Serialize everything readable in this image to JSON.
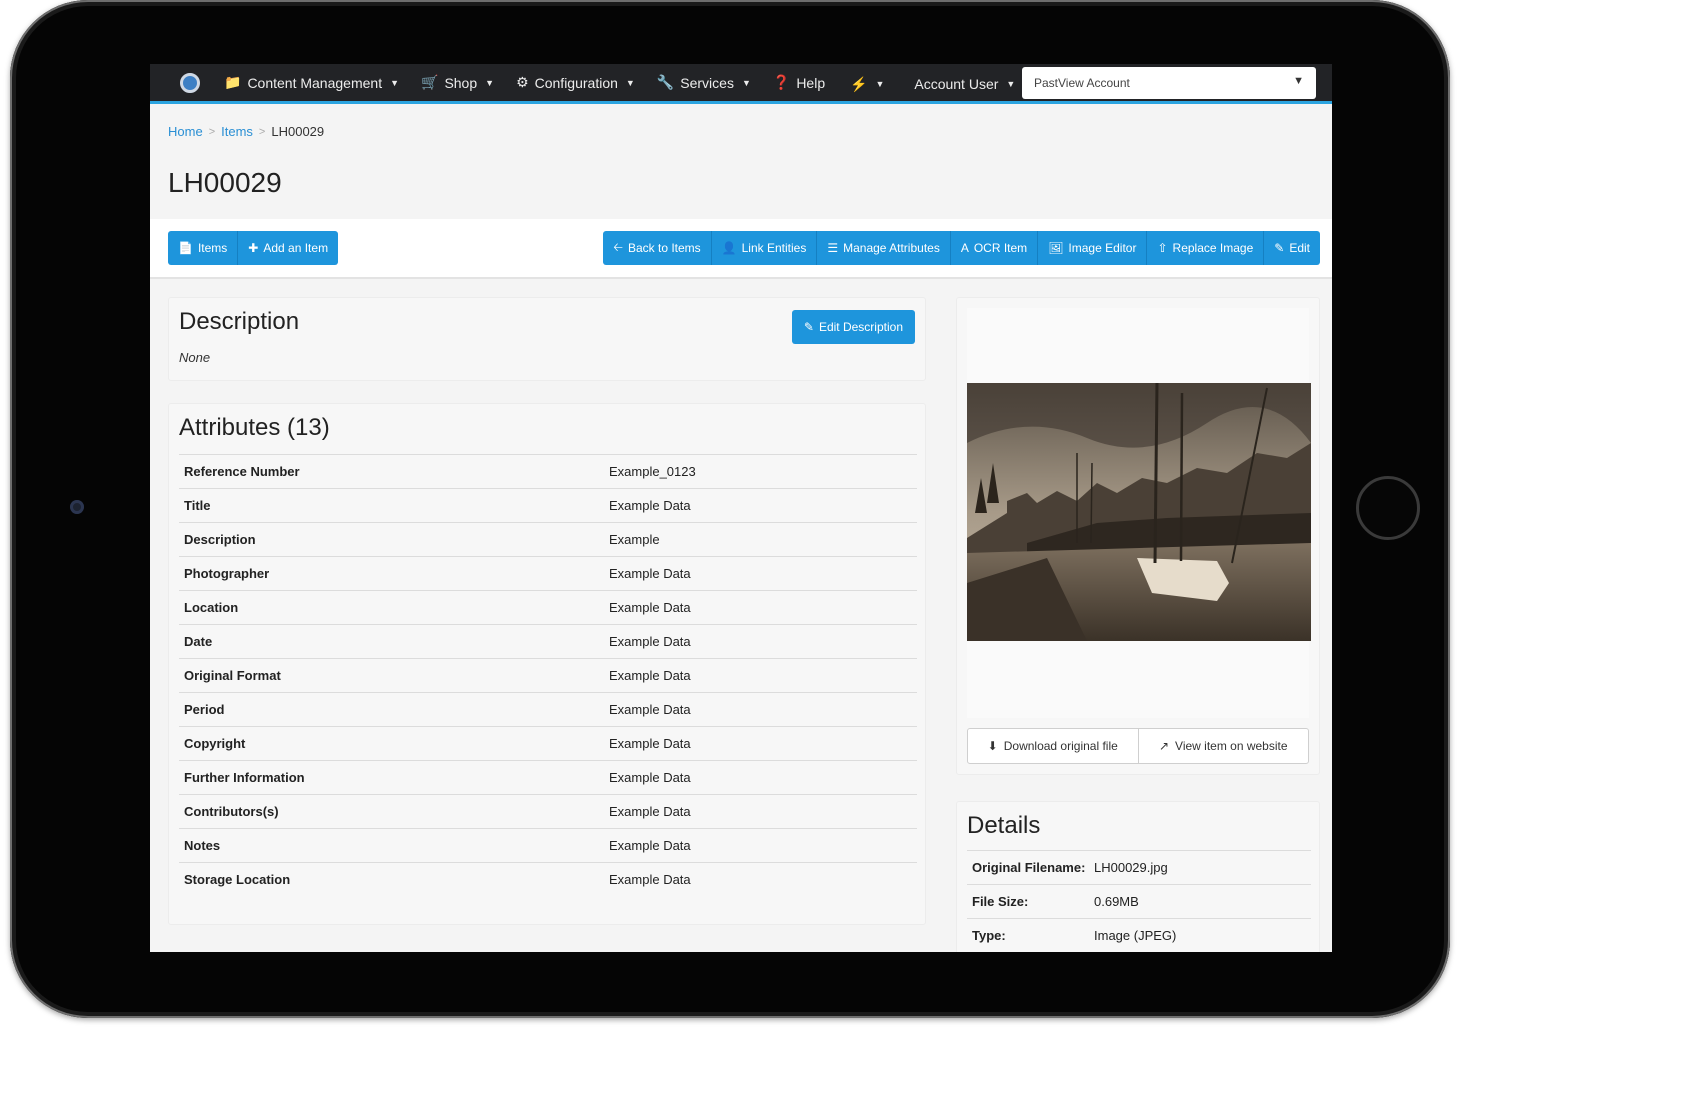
{
  "nav": {
    "items": [
      {
        "label": "Content Management",
        "icon": "folder-icon"
      },
      {
        "label": "Shop",
        "icon": "cart-icon"
      },
      {
        "label": "Configuration",
        "icon": "gear-icon"
      },
      {
        "label": "Services",
        "icon": "wrench-icon"
      },
      {
        "label": "Help",
        "icon": "help-icon"
      }
    ],
    "bolt_icon": "bolt-icon",
    "account_user": "Account User",
    "account_select": "PastView Account"
  },
  "breadcrumb": {
    "home": "Home",
    "items": "Items",
    "current": "LH00029"
  },
  "page_title": "LH00029",
  "toolbar": {
    "left": [
      {
        "label": "Items",
        "icon": "file-icon"
      },
      {
        "label": "Add an Item",
        "icon": "plus-icon"
      }
    ],
    "right": [
      {
        "label": "Back to Items",
        "icon": "arrow-left-icon"
      },
      {
        "label": "Link Entities",
        "icon": "user-icon"
      },
      {
        "label": "Manage Attributes",
        "icon": "list-icon"
      },
      {
        "label": "OCR Item",
        "icon": "text-icon"
      },
      {
        "label": "Image Editor",
        "icon": "image-icon"
      },
      {
        "label": "Replace Image",
        "icon": "upload-icon"
      },
      {
        "label": "Edit",
        "icon": "pencil-icon"
      }
    ]
  },
  "description": {
    "title": "Description",
    "value": "None",
    "edit_label": "Edit Description"
  },
  "attributes": {
    "title": "Attributes (13)",
    "rows": [
      {
        "key": "Reference Number",
        "value": "Example_0123"
      },
      {
        "key": "Title",
        "value": "Example Data"
      },
      {
        "key": "Description",
        "value": "Example"
      },
      {
        "key": "Photographer",
        "value": "Example Data"
      },
      {
        "key": "Location",
        "value": "Example Data"
      },
      {
        "key": "Date",
        "value": "Example Data"
      },
      {
        "key": "Original Format",
        "value": "Example Data"
      },
      {
        "key": "Period",
        "value": "Example Data"
      },
      {
        "key": "Copyright",
        "value": "Example Data"
      },
      {
        "key": "Further Information",
        "value": "Example Data"
      },
      {
        "key": "Contributors(s)",
        "value": "Example Data"
      },
      {
        "key": "Notes",
        "value": "Example Data"
      },
      {
        "key": "Storage Location",
        "value": "Example Data"
      }
    ]
  },
  "image_actions": {
    "download": "Download original file",
    "view": "View item on website"
  },
  "details": {
    "title": "Details",
    "rows": [
      {
        "key": "Original Filename:",
        "value": "LH00029.jpg"
      },
      {
        "key": "File Size:",
        "value": "0.69MB"
      },
      {
        "key": "Type:",
        "value": "Image (JPEG)"
      }
    ]
  },
  "colors": {
    "accent": "#1e95dc",
    "navbar": "#222326",
    "nav_border": "#2ba4e0",
    "link": "#2a8fd4"
  }
}
